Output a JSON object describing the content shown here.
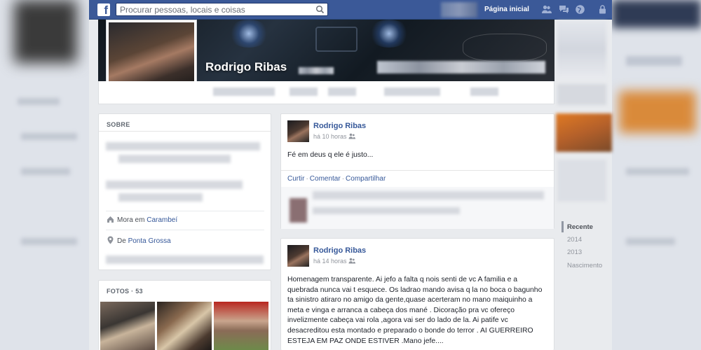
{
  "topbar": {
    "logo": "f",
    "search_placeholder": "Procurar pessoas, locais e coisas",
    "home_label": "Página inicial"
  },
  "profile": {
    "name": "Rodrigo Ribas"
  },
  "about": {
    "heading": "SOBRE",
    "lives_prefix": "Mora em ",
    "lives_city": "Carambeí",
    "from_prefix": "De ",
    "from_city": "Ponta Grossa"
  },
  "photos": {
    "heading": "FOTOS · 53"
  },
  "posts": [
    {
      "author": "Rodrigo Ribas",
      "time": "há 10 horas",
      "text": "Fé em deus q ele é justo...",
      "actions": [
        "Curtir",
        "Comentar",
        "Compartilhar"
      ]
    },
    {
      "author": "Rodrigo Ribas",
      "time": "há 14 horas",
      "text": "Homenagem transparente. Ai jefo a falta q nois senti de vc A familia e a quebrada nunca vai t esquece. Os ladrao mando avisa q la no boca o bagunho ta sinistro atiraro no amigo da gente,quase acerteram no mano maiquinho a meta e vinga e arranca a cabeça dos mané . Dicoração pra vc ofereço invelizmente cabeça vai rola ,agora vai ser do lado de la. Ai patife vc desacreditou esta montado e preparado o bonde do terror . AI GUERREIRO ESTEJA EM PAZ ONDE ESTIVER .Mano jefe...."
    }
  ],
  "timeline": {
    "items": [
      "Recente",
      "2014",
      "2013",
      "Nascimento"
    ]
  },
  "colors": {
    "brand": "#3b5998",
    "link": "#365899",
    "page_bg": "#e9ebee"
  }
}
